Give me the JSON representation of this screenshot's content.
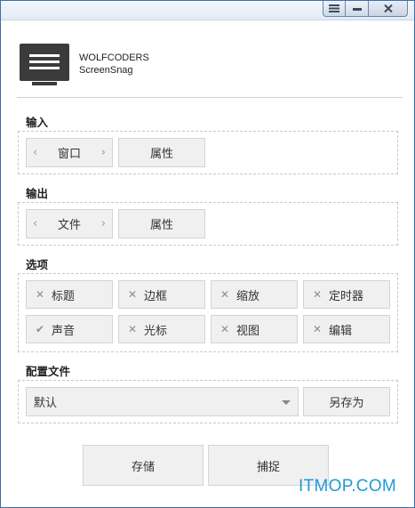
{
  "window": {
    "title": "",
    "buttons": {
      "menu": "menu-icon",
      "minimize": "minimize-icon",
      "close": "close-icon"
    }
  },
  "brand": {
    "company": "WOLFCODERS",
    "product": "ScreenSnag"
  },
  "input": {
    "section_label": "输入",
    "source": {
      "value": "窗口",
      "prev": "‹",
      "next": "›"
    },
    "properties_label": "属性"
  },
  "output": {
    "section_label": "输出",
    "target": {
      "value": "文件",
      "prev": "‹",
      "next": "›"
    },
    "properties_label": "属性"
  },
  "options": {
    "section_label": "选项",
    "items": [
      {
        "label": "标题",
        "checked": false,
        "mark": "✕"
      },
      {
        "label": "边框",
        "checked": false,
        "mark": "✕"
      },
      {
        "label": "缩放",
        "checked": false,
        "mark": "✕"
      },
      {
        "label": "定时器",
        "checked": false,
        "mark": "✕"
      },
      {
        "label": "声音",
        "checked": true,
        "mark": "✔"
      },
      {
        "label": "光标",
        "checked": false,
        "mark": "✕"
      },
      {
        "label": "视图",
        "checked": false,
        "mark": "✕"
      },
      {
        "label": "编辑",
        "checked": false,
        "mark": "✕"
      }
    ]
  },
  "profile": {
    "section_label": "配置文件",
    "selected": "默认",
    "save_as_label": "另存为"
  },
  "actions": {
    "save_label": "存储",
    "capture_label": "捕捉"
  },
  "watermark": "ITMOP.COM",
  "colors": {
    "frame": "#3d6ea8",
    "button_bg": "#f0f0f0",
    "watermark": "#1f9ad6"
  }
}
